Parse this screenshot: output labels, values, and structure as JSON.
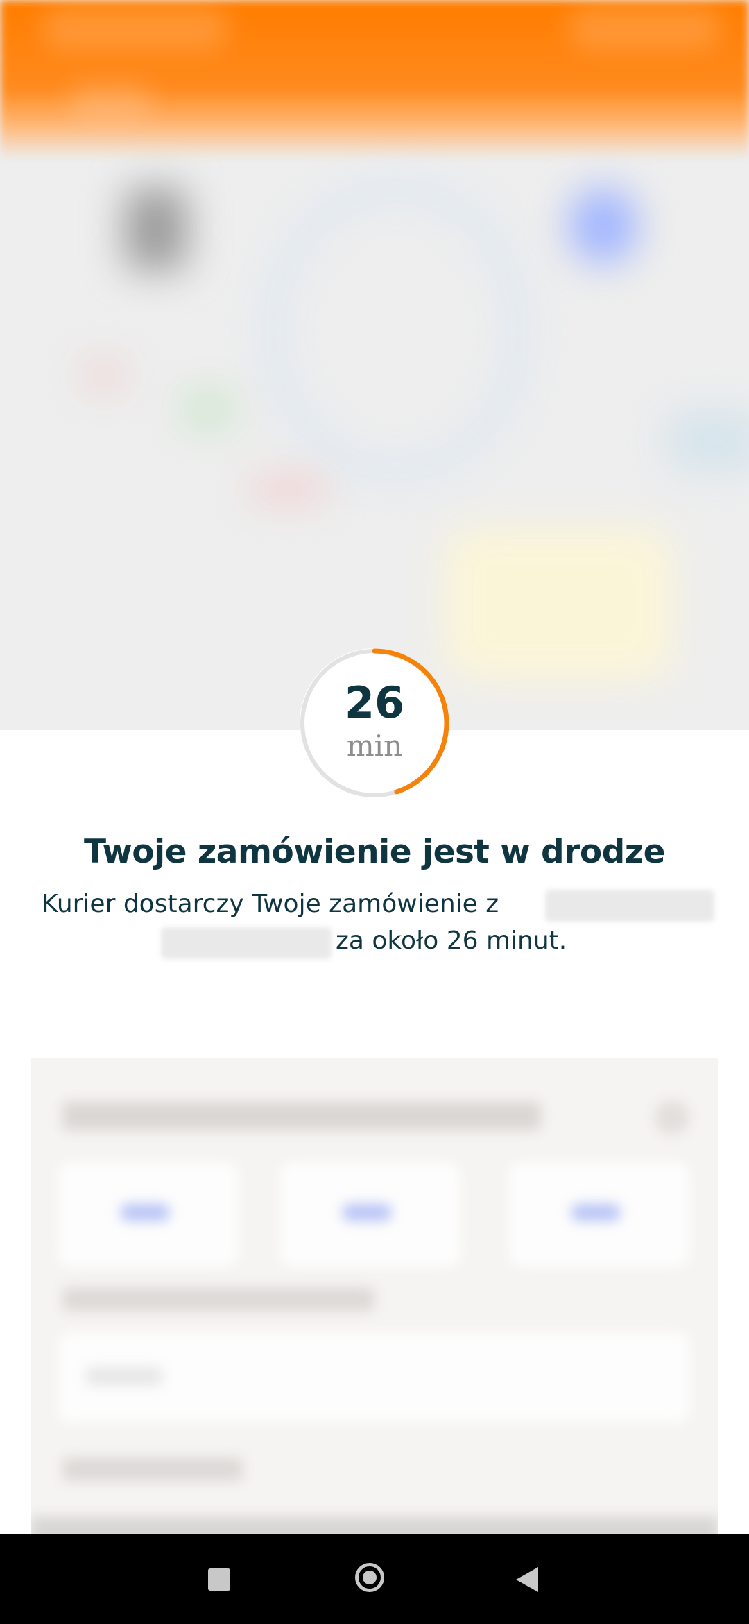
{
  "timer": {
    "minutes": "26",
    "unit": "min",
    "progress_fraction": 0.45,
    "accent_color": "#f5820b",
    "track_color": "#e2e2e2"
  },
  "status": {
    "title": "Twoje zamówienie jest w drodze",
    "line1": "Kurier dostarczy Twoje zamówienie z",
    "line2": "za około 26 minut."
  },
  "colors": {
    "header_orange": "#ff7d00",
    "text_dark": "#0f3541",
    "card_bg": "#f6f4f2"
  },
  "navbar": {
    "recents_icon": "square-icon",
    "home_icon": "circle-icon",
    "back_icon": "triangle-back-icon"
  }
}
